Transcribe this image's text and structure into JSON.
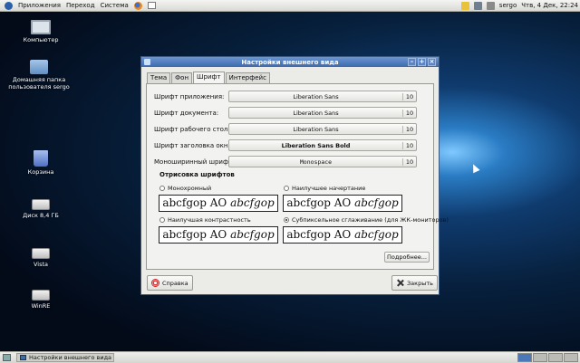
{
  "top_panel": {
    "menus": [
      "Приложения",
      "Переход",
      "Система"
    ],
    "user": "sergo",
    "datetime": "Чтв, 4 Дек, 22:24"
  },
  "desktop": {
    "icons": [
      {
        "label": "Компьютер",
        "icon": "computer-icon"
      },
      {
        "label": "Домашняя папка пользователя sergo",
        "icon": "home-folder-icon"
      },
      {
        "label": "Корзина",
        "icon": "trash-icon"
      },
      {
        "label": "Диск 8,4 ГБ",
        "icon": "drive-icon"
      },
      {
        "label": "Vista",
        "icon": "drive-icon"
      },
      {
        "label": "WinRE",
        "icon": "drive-icon"
      }
    ]
  },
  "window": {
    "title": "Настройки внешнего вида",
    "tabs": [
      "Тема",
      "Фон",
      "Шрифт",
      "Интерфейс"
    ],
    "active_tab": "Шрифт",
    "fonts": [
      {
        "label": "Шрифт приложения:",
        "font": "Liberation Sans",
        "size": "10"
      },
      {
        "label": "Шрифт документа:",
        "font": "Liberation Sans",
        "size": "10"
      },
      {
        "label": "Шрифт рабочего стола:",
        "font": "Liberation Sans",
        "size": "10"
      },
      {
        "label": "Шрифт заголовка окна:",
        "font": "Liberation Sans Bold",
        "size": "10"
      },
      {
        "label": "Моноширинный шрифт:",
        "font": "Monospace",
        "size": "10"
      }
    ],
    "rendering_title": "Отрисовка шрифтов",
    "rendering_options": [
      {
        "label": "Монохромный",
        "selected": false
      },
      {
        "label": "Наилучшее начертание",
        "selected": false
      },
      {
        "label": "Наилучшая контрастность",
        "selected": false
      },
      {
        "label": "Субпиксельное сглаживание (для ЖК-мониторов)",
        "selected": true
      }
    ],
    "preview_plain": "abcfgop AO ",
    "preview_italic": "abcfgop",
    "details_label": "Подробнее...",
    "help_label": "Справка",
    "close_label": "Закрыть"
  },
  "bottom_panel": {
    "task": "Настройки внешнего вида"
  },
  "colors": {
    "titlebar": "#3b6aae",
    "window_bg": "#ebebe8",
    "desktop": "#07203d"
  }
}
